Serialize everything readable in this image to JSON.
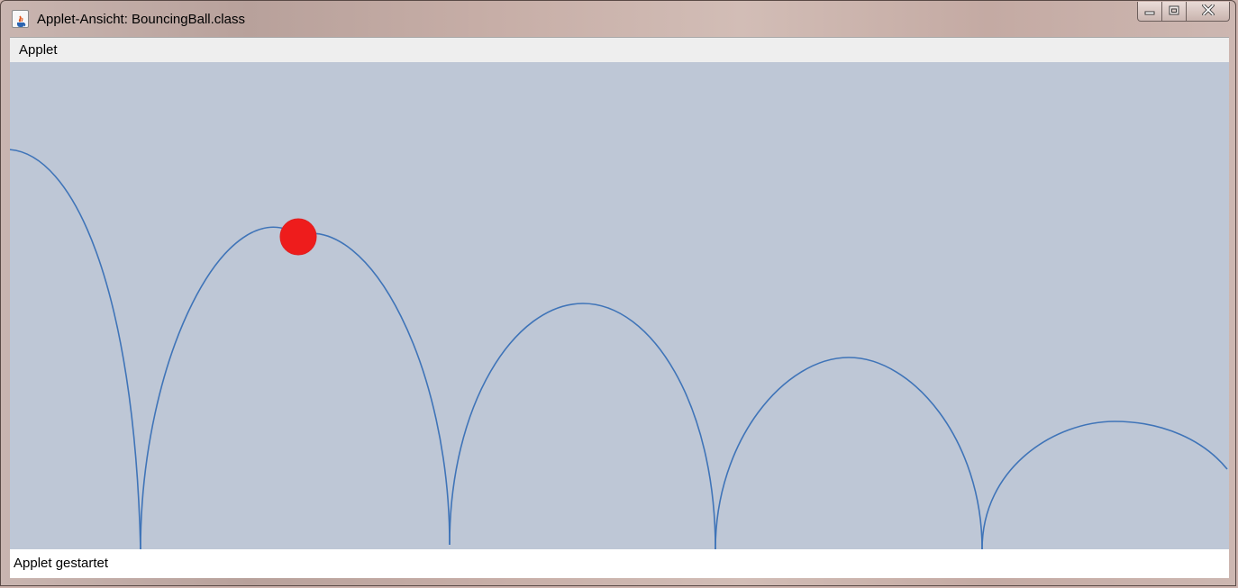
{
  "window": {
    "title": "Applet-Ansicht: BouncingBall.class"
  },
  "titlebar_icons": {
    "app": "java-cup-icon",
    "minimize": "minimize-icon",
    "maximize": "maximize-icon",
    "close": "close-icon"
  },
  "menubar": {
    "items": [
      {
        "label": "Applet"
      }
    ]
  },
  "status": {
    "text": "Applet gestartet"
  },
  "colors": {
    "canvas_background": "#bec7d6",
    "trajectory": "#3f74b8",
    "ball": "#ee1c1c"
  }
}
